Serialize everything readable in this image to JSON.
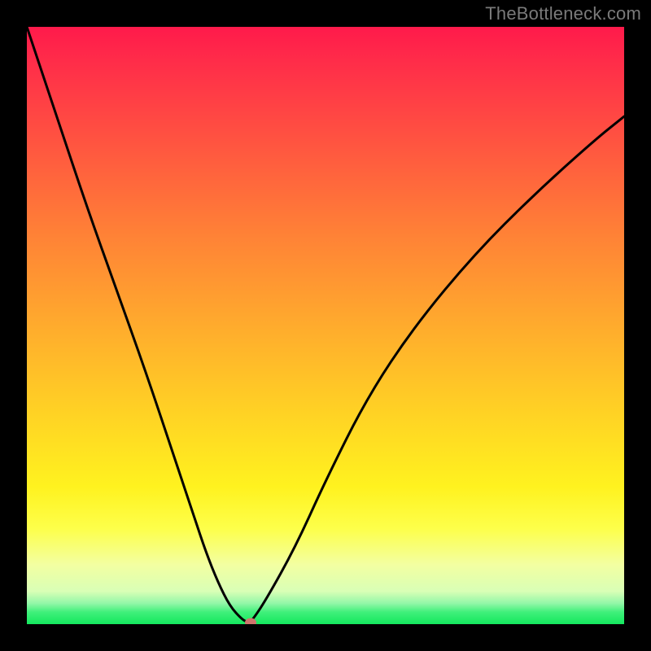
{
  "watermark": "TheBottleneck.com",
  "chart_data": {
    "type": "line",
    "title": "",
    "xlabel": "",
    "ylabel": "",
    "xlim": [
      0,
      100
    ],
    "ylim": [
      0,
      100
    ],
    "grid": false,
    "legend": false,
    "series": [
      {
        "name": "bottleneck-curve",
        "x": [
          0,
          5,
          10,
          15,
          20,
          25,
          28,
          30,
          32,
          34,
          36,
          37,
          37.5,
          40,
          45,
          50,
          57,
          65,
          75,
          85,
          95,
          100
        ],
        "values": [
          100,
          85,
          70,
          56,
          42,
          27,
          18,
          12,
          7,
          3,
          0.8,
          0.3,
          0.3,
          4,
          13,
          24,
          38,
          50,
          62,
          72,
          81,
          85
        ]
      }
    ],
    "marker": {
      "x": 37.5,
      "y": 0.3,
      "color": "#cf746c"
    },
    "background_gradient": {
      "orientation": "vertical",
      "stops": [
        {
          "pos": 0.0,
          "color": "#ff1a4b"
        },
        {
          "pos": 0.5,
          "color": "#ffab2d"
        },
        {
          "pos": 0.77,
          "color": "#fff21f"
        },
        {
          "pos": 0.95,
          "color": "#d9ffb6"
        },
        {
          "pos": 1.0,
          "color": "#14e85e"
        }
      ]
    }
  }
}
